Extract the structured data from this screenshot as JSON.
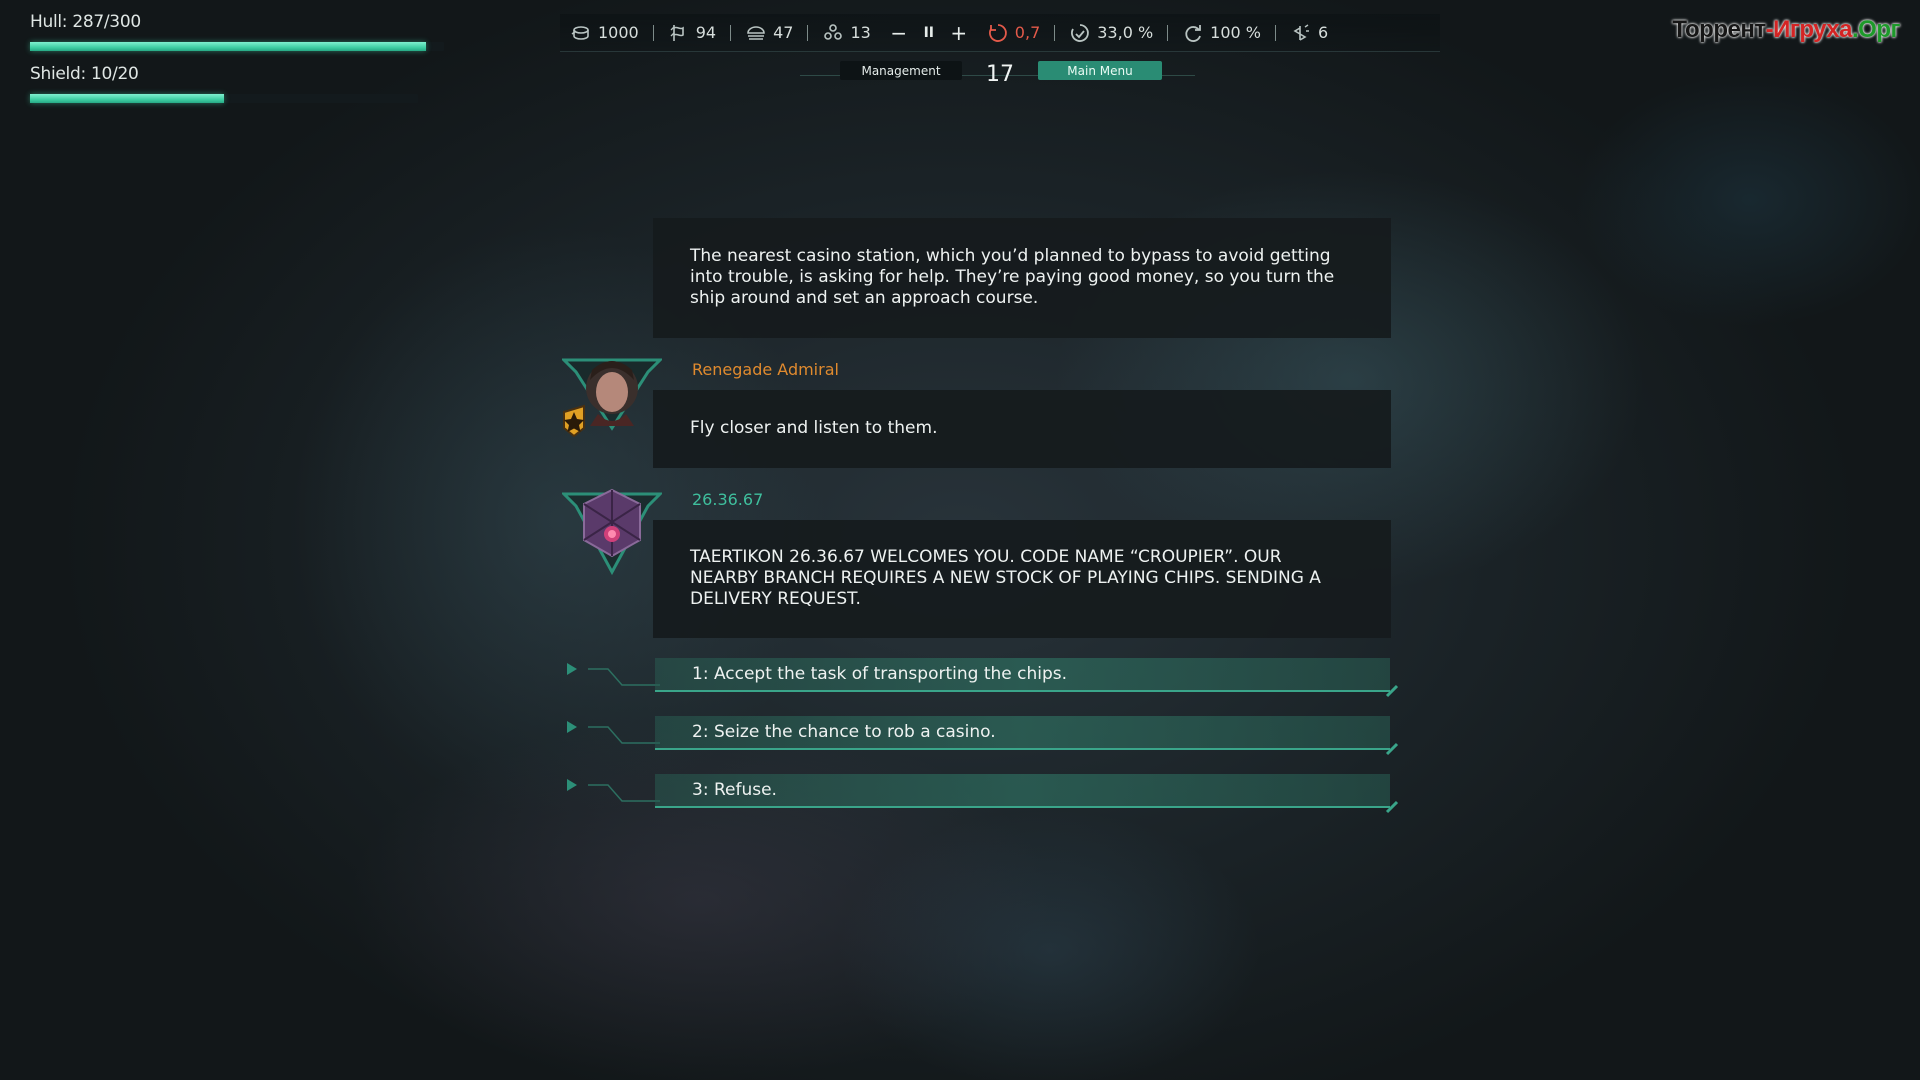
{
  "hud": {
    "hull_label": "Hull: 287/300",
    "hull_fraction": 0.957,
    "shield_label": "Shield: 10/20",
    "shield_fraction": 0.5
  },
  "resources": [
    {
      "icon": "credits-icon",
      "value": "1000"
    },
    {
      "icon": "crew-icon",
      "value": "94"
    },
    {
      "icon": "food-icon",
      "value": "47"
    },
    {
      "icon": "supplies-icon",
      "value": "13"
    }
  ],
  "speed_controls": {
    "minus": "−",
    "pause": "II",
    "plus": "+"
  },
  "stats": [
    {
      "icon": "danger-icon",
      "value": "0,7"
    },
    {
      "icon": "progress-icon",
      "value": "33,0 %"
    },
    {
      "icon": "repeat-icon",
      "value": "100 %"
    },
    {
      "icon": "mood-icon",
      "value": "6"
    }
  ],
  "tabs": {
    "management": "Management",
    "main_menu": "Main Menu",
    "turn": "17"
  },
  "watermark": {
    "part1": "Торрент",
    "part2": "-Игруха",
    "part3": ".Орг"
  },
  "dialogue": {
    "intro": "The nearest casino station, which you’d planned to bypass to avoid getting into trouble, is asking for help. They’re paying good money, so you turn the ship around and set an approach course.",
    "admiral_name": "Renegade Admiral",
    "admiral_line": "Fly closer and listen to them.",
    "station_name": "26.36.67",
    "station_line": "TAERTIKON 26.36.67 WELCOMES YOU. CODE NAME “CROUPIER”. OUR NEARBY BRANCH REQUIRES A NEW STOCK OF PLAYING CHIPS. SENDING A DELIVERY REQUEST.",
    "options": [
      "1: Accept the task of transporting the chips.",
      "2: Seize the chance to rob a casino.",
      "3: Refuse."
    ]
  },
  "colors": {
    "accent": "#3fcfa4",
    "admiral": "#e08a2e",
    "station": "#3fbf9d",
    "alert": "#e45a4a"
  }
}
